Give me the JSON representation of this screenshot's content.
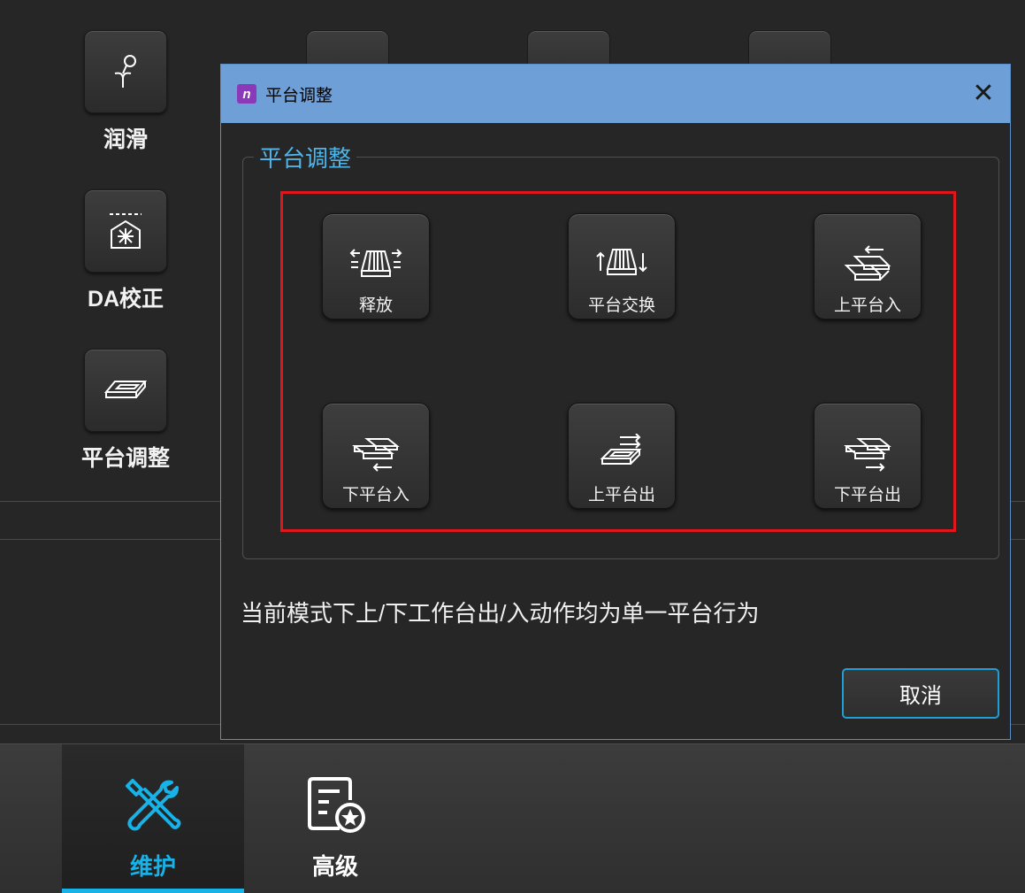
{
  "background_tools": [
    {
      "label": "润滑",
      "icon": "lubrication-icon"
    },
    {
      "label": "DA校正",
      "icon": "da-calibration-icon"
    },
    {
      "label": "平台调整",
      "icon": "platform-adjust-icon"
    }
  ],
  "bottom_tabs": [
    {
      "label": "维护",
      "icon": "wrench-screwdriver-icon",
      "active": true
    },
    {
      "label": "高级",
      "icon": "document-star-icon",
      "active": false
    }
  ],
  "dialog": {
    "title": "平台调整",
    "app_icon_letter": "n",
    "close_symbol": "✕",
    "group_title": "平台调整",
    "buttons": [
      {
        "label": "释放",
        "icon": "release-icon"
      },
      {
        "label": "平台交换",
        "icon": "platform-swap-icon"
      },
      {
        "label": "上平台入",
        "icon": "upper-platform-in-icon"
      },
      {
        "label": "下平台入",
        "icon": "lower-platform-in-icon"
      },
      {
        "label": "上平台出",
        "icon": "upper-platform-out-icon"
      },
      {
        "label": "下平台出",
        "icon": "lower-platform-out-icon"
      }
    ],
    "status_text": "当前模式下上/下工作台出/入动作均为单一平台行为",
    "cancel_label": "取消"
  },
  "colors": {
    "accent": "#19b2e6",
    "titlebar": "#6e9fd6",
    "highlight": "#e0161a",
    "background": "#262626"
  }
}
